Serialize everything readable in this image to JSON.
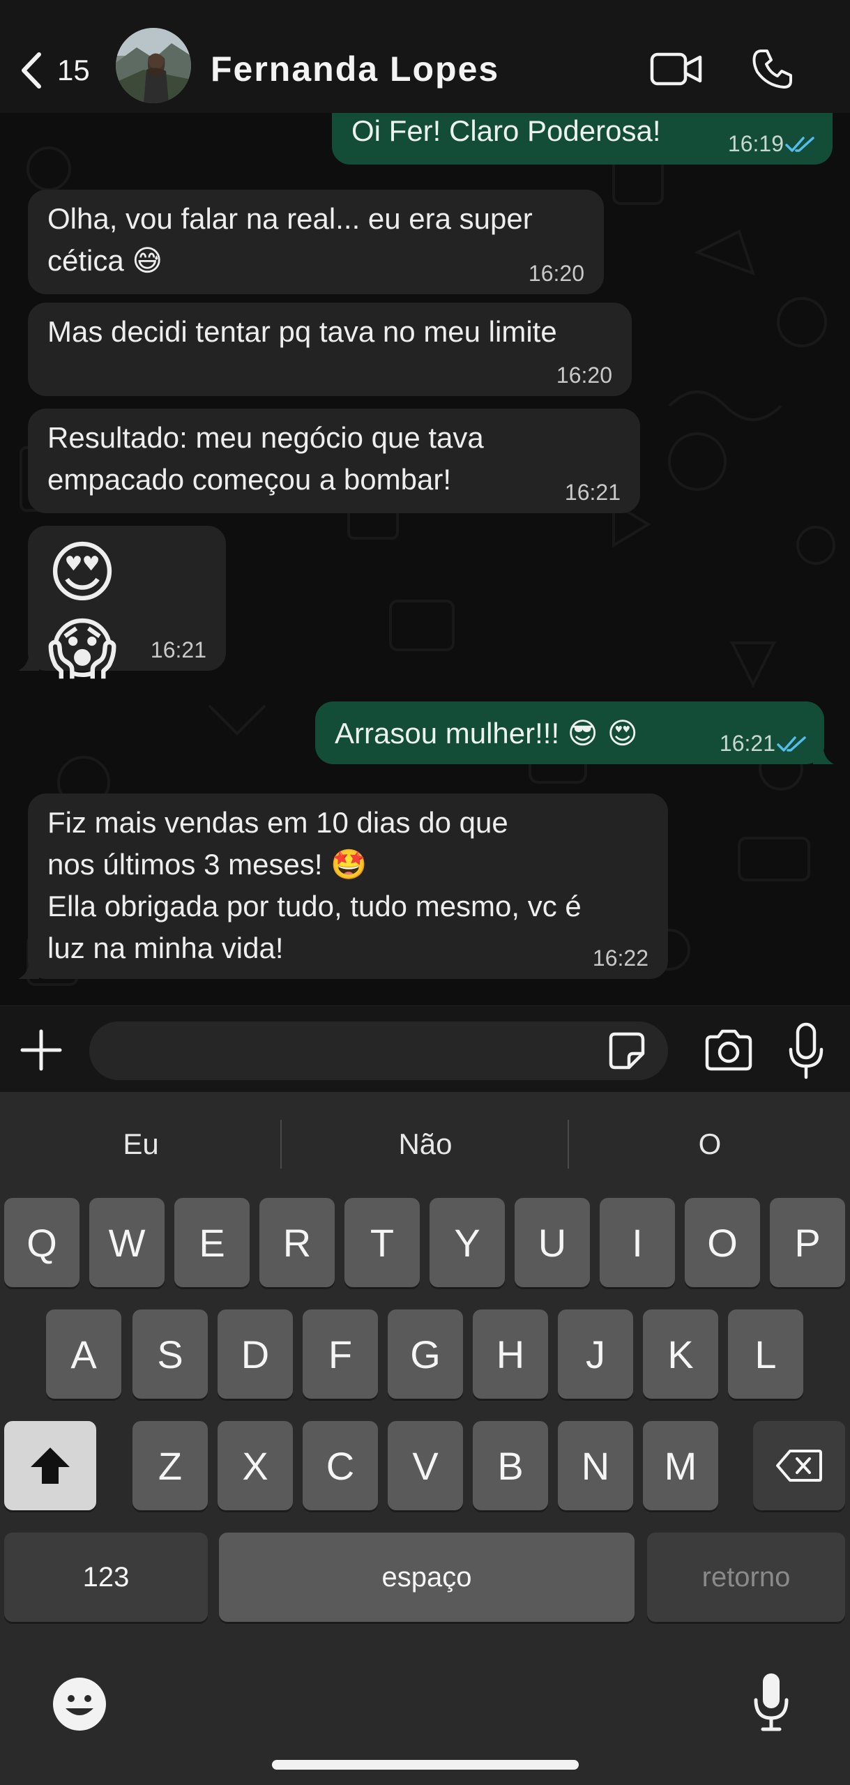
{
  "header": {
    "back_count": "15",
    "contact_name": "Fernanda Lopes",
    "icons": [
      "back-chevron-icon",
      "video-call-icon",
      "phone-call-icon"
    ]
  },
  "messages": [
    {
      "direction": "out",
      "text": "Oi Fer! Claro Poderosa!",
      "time": "16:19",
      "read": true
    },
    {
      "direction": "in",
      "lines": [
        "Olha, vou falar na real... eu era super",
        "cética"
      ],
      "emoji": "😅",
      "time": "16:20"
    },
    {
      "direction": "in",
      "text": "Mas decidi tentar pq tava no meu limite",
      "time": "16:20"
    },
    {
      "direction": "in",
      "lines": [
        "Resultado: meu negócio que tava",
        "empacado começou a bombar!"
      ],
      "time": "16:21"
    },
    {
      "direction": "in",
      "emoji_only": "😍 😱",
      "time": "16:21"
    },
    {
      "direction": "out",
      "text": "Arrasou mulher!!!",
      "emoji": "😎 😍",
      "time": "16:21",
      "read": true
    },
    {
      "direction": "in",
      "lines": [
        "Fiz mais vendas em 10 dias do que",
        "nos últimos 3 meses!",
        "Ella obrigada por tudo, tudo mesmo, vc é",
        "luz na minha vida!"
      ],
      "emoji": "🤩",
      "time": "16:22"
    }
  ],
  "input_bar": {
    "placeholder": "",
    "icons": [
      "plus-icon",
      "sticker-icon",
      "camera-icon",
      "microphone-icon"
    ]
  },
  "keyboard": {
    "suggestions": [
      "Eu",
      "Não",
      "O"
    ],
    "row1": [
      "Q",
      "W",
      "E",
      "R",
      "T",
      "Y",
      "U",
      "I",
      "O",
      "P"
    ],
    "row2": [
      "A",
      "S",
      "D",
      "F",
      "G",
      "H",
      "J",
      "K",
      "L"
    ],
    "row3": [
      "Z",
      "X",
      "C",
      "V",
      "B",
      "N",
      "M"
    ],
    "numbers_label": "123",
    "space_label": "espaço",
    "return_label": "retorno"
  },
  "colors": {
    "outgoing_bubble": "#144d37",
    "incoming_bubble": "#232323",
    "read_ticks": "#53bdeb",
    "background": "#0e0e0e"
  }
}
